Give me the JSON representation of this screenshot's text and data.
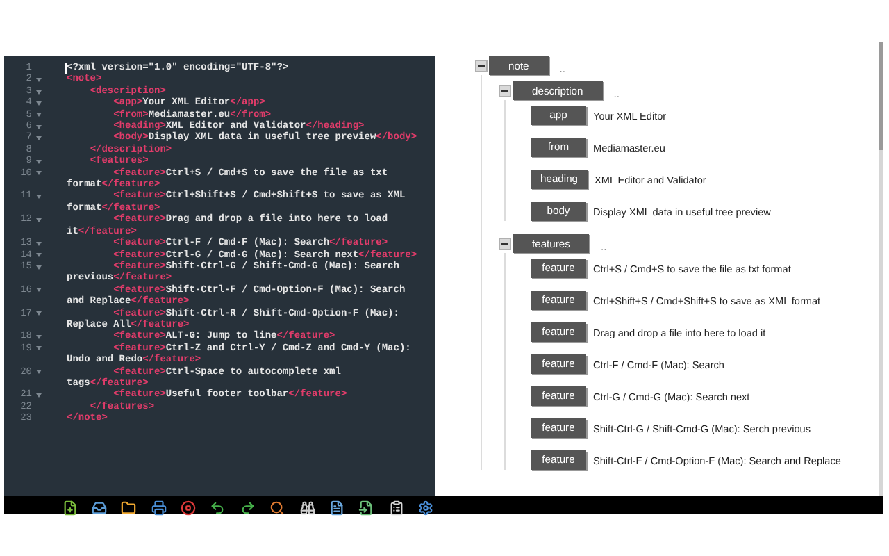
{
  "editor": {
    "lines": [
      {
        "number": "1",
        "fold": false,
        "cursor": true,
        "segments": [
          {
            "kind": "text",
            "text": "<?xml version=\"1.0\" encoding=\"UTF-8\"?>"
          }
        ]
      },
      {
        "number": "2",
        "fold": true,
        "segments": [
          {
            "kind": "tag",
            "text": "<note>"
          }
        ]
      },
      {
        "number": "3",
        "fold": true,
        "segments": [
          {
            "kind": "tag",
            "text": "    <description>"
          }
        ]
      },
      {
        "number": "4",
        "fold": true,
        "segments": [
          {
            "kind": "tag",
            "text": "        <app>"
          },
          {
            "kind": "text",
            "text": "Your XML Editor"
          },
          {
            "kind": "tag",
            "text": "</app>"
          }
        ]
      },
      {
        "number": "5",
        "fold": true,
        "segments": [
          {
            "kind": "tag",
            "text": "        <from>"
          },
          {
            "kind": "text",
            "text": "Mediamaster.eu"
          },
          {
            "kind": "tag",
            "text": "</from>"
          }
        ]
      },
      {
        "number": "6",
        "fold": true,
        "segments": [
          {
            "kind": "tag",
            "text": "        <heading>"
          },
          {
            "kind": "text",
            "text": "XML Editor and Validator"
          },
          {
            "kind": "tag",
            "text": "</heading>"
          }
        ]
      },
      {
        "number": "7",
        "fold": true,
        "segments": [
          {
            "kind": "tag",
            "text": "        <body>"
          },
          {
            "kind": "text",
            "text": "Display XML data in useful tree preview"
          },
          {
            "kind": "tag",
            "text": "</body>"
          }
        ]
      },
      {
        "number": "8",
        "fold": false,
        "segments": [
          {
            "kind": "tag",
            "text": "    </description>"
          }
        ]
      },
      {
        "number": "9",
        "fold": true,
        "segments": [
          {
            "kind": "tag",
            "text": "    <features>"
          }
        ]
      },
      {
        "number": "10",
        "fold": true,
        "segments": [
          {
            "kind": "tag",
            "text": "        <feature>"
          },
          {
            "kind": "text",
            "text": "Ctrl+S / Cmd+S to save the file as txt format"
          },
          {
            "kind": "tag",
            "text": "</feature>"
          }
        ]
      },
      {
        "number": "11",
        "fold": true,
        "segments": [
          {
            "kind": "tag",
            "text": "        <feature>"
          },
          {
            "kind": "text",
            "text": "Ctrl+Shift+S / Cmd+Shift+S to save as XML format"
          },
          {
            "kind": "tag",
            "text": "</feature>"
          }
        ]
      },
      {
        "number": "12",
        "fold": true,
        "segments": [
          {
            "kind": "tag",
            "text": "        <feature>"
          },
          {
            "kind": "text",
            "text": "Drag and drop a file into here to load it"
          },
          {
            "kind": "tag",
            "text": "</feature>"
          }
        ]
      },
      {
        "number": "13",
        "fold": true,
        "segments": [
          {
            "kind": "tag",
            "text": "        <feature>"
          },
          {
            "kind": "text",
            "text": "Ctrl-F / Cmd-F (Mac): Search"
          },
          {
            "kind": "tag",
            "text": "</feature>"
          }
        ]
      },
      {
        "number": "14",
        "fold": true,
        "segments": [
          {
            "kind": "tag",
            "text": "        <feature>"
          },
          {
            "kind": "text",
            "text": "Ctrl-G / Cmd-G (Mac): Search next"
          },
          {
            "kind": "tag",
            "text": "</feature>"
          }
        ]
      },
      {
        "number": "15",
        "fold": true,
        "segments": [
          {
            "kind": "tag",
            "text": "        <feature>"
          },
          {
            "kind": "text",
            "text": "Shift-Ctrl-G / Shift-Cmd-G (Mac): Search previous"
          },
          {
            "kind": "tag",
            "text": "</feature>"
          }
        ]
      },
      {
        "number": "16",
        "fold": true,
        "segments": [
          {
            "kind": "tag",
            "text": "        <feature>"
          },
          {
            "kind": "text",
            "text": "Shift-Ctrl-F / Cmd-Option-F (Mac): Search and Replace"
          },
          {
            "kind": "tag",
            "text": "</feature>"
          }
        ]
      },
      {
        "number": "17",
        "fold": true,
        "segments": [
          {
            "kind": "tag",
            "text": "        <feature>"
          },
          {
            "kind": "text",
            "text": "Shift-Ctrl-R / Shift-Cmd-Option-F (Mac): Replace All"
          },
          {
            "kind": "tag",
            "text": "</feature>"
          }
        ]
      },
      {
        "number": "18",
        "fold": true,
        "segments": [
          {
            "kind": "tag",
            "text": "        <feature>"
          },
          {
            "kind": "text",
            "text": "ALT-G: Jump to line"
          },
          {
            "kind": "tag",
            "text": "</feature>"
          }
        ]
      },
      {
        "number": "19",
        "fold": true,
        "segments": [
          {
            "kind": "tag",
            "text": "        <feature>"
          },
          {
            "kind": "text",
            "text": "Ctrl-Z and Ctrl-Y / Cmd-Z and Cmd-Y (Mac): Undo and Redo"
          },
          {
            "kind": "tag",
            "text": "</feature>"
          }
        ]
      },
      {
        "number": "20",
        "fold": true,
        "segments": [
          {
            "kind": "tag",
            "text": "        <feature>"
          },
          {
            "kind": "text",
            "text": "Ctrl-Space to autocomplete xml tags"
          },
          {
            "kind": "tag",
            "text": "</feature>"
          }
        ]
      },
      {
        "number": "21",
        "fold": true,
        "segments": [
          {
            "kind": "tag",
            "text": "        <feature>"
          },
          {
            "kind": "text",
            "text": "Useful footer toolbar"
          },
          {
            "kind": "tag",
            "text": "</feature>"
          }
        ]
      },
      {
        "number": "22",
        "fold": false,
        "segments": [
          {
            "kind": "tag",
            "text": "    </features>"
          }
        ]
      },
      {
        "number": "23",
        "fold": false,
        "segments": [
          {
            "kind": "tag",
            "text": "</note>"
          }
        ]
      }
    ]
  },
  "tree": {
    "name": "note",
    "expanded": true,
    "value": "..",
    "children": [
      {
        "name": "description",
        "expanded": true,
        "value": "..",
        "children": [
          {
            "name": "app",
            "value": "Your XML Editor"
          },
          {
            "name": "from",
            "value": "Mediamaster.eu"
          },
          {
            "name": "heading",
            "value": "XML Editor and Validator"
          },
          {
            "name": "body",
            "value": "Display XML data in useful tree preview"
          }
        ]
      },
      {
        "name": "features",
        "expanded": true,
        "value": "..",
        "children": [
          {
            "name": "feature",
            "value": "Ctrl+S / Cmd+S to save the file as txt format"
          },
          {
            "name": "feature",
            "value": "Ctrl+Shift+S / Cmd+Shift+S to save as XML format"
          },
          {
            "name": "feature",
            "value": "Drag and drop a file into here to load it"
          },
          {
            "name": "feature",
            "value": "Ctrl-F / Cmd-F (Mac): Search"
          },
          {
            "name": "feature",
            "value": "Ctrl-G / Cmd-G (Mac): Search next"
          },
          {
            "name": "feature",
            "value": "Shift-Ctrl-G / Shift-Cmd-G (Mac): Serch previous"
          },
          {
            "name": "feature",
            "value": "Shift-Ctrl-F / Cmd-Option-F (Mac): Search and Replace"
          }
        ]
      }
    ]
  }
}
